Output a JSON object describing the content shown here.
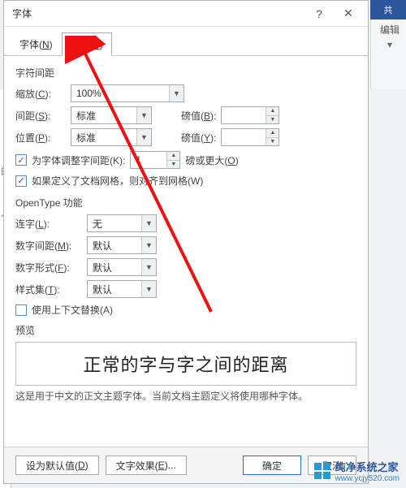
{
  "bg": {
    "share_label": "共",
    "edit_label": "编辑",
    "doc_char1": "的",
    "doc_char2": "入"
  },
  "dialog": {
    "title": "字体",
    "tabs": {
      "font": {
        "text": "字体(",
        "hotkey": "N",
        "suffix": ")"
      },
      "advanced": {
        "text": "高级(",
        "hotkey": "V",
        "suffix": ")"
      }
    },
    "section_spacing_title": "字符间距",
    "scale": {
      "label_pre": "缩放(",
      "hotkey": "C",
      "label_post": "):",
      "value": "100%"
    },
    "spacing": {
      "label_pre": "间距(",
      "hotkey": "S",
      "label_post": "):",
      "value": "标准",
      "pt_label_pre": "磅值(",
      "pt_hotkey": "B",
      "pt_label_post": "):",
      "pt_value": ""
    },
    "position": {
      "label_pre": "位置(",
      "hotkey": "P",
      "label_post": "):",
      "value": "标准",
      "pt_label_pre": "磅值(",
      "pt_hotkey": "Y",
      "pt_label_post": "):",
      "pt_value": ""
    },
    "kerning": {
      "checked": true,
      "label_pre": "为字体调整字间距(",
      "hotkey": "K",
      "label_post": "):",
      "value": "1",
      "unit_pre": "磅或更大(",
      "unit_hotkey": "O",
      "unit_post": ")"
    },
    "grid": {
      "checked": true,
      "label_pre": "如果定义了文档网格，则对齐到网格(",
      "hotkey": "W",
      "label_post": ")"
    },
    "section_opentype_title": "OpenType 功能",
    "ligature": {
      "label_pre": "连字(",
      "hotkey": "L",
      "label_post": "):",
      "value": "无"
    },
    "num_spacing": {
      "label_pre": "数字间距(",
      "hotkey": "M",
      "label_post": "):",
      "value": "默认"
    },
    "num_form": {
      "label_pre": "数字形式(",
      "hotkey": "F",
      "label_post": "):",
      "value": "默认"
    },
    "stylistic": {
      "label_pre": "样式集(",
      "hotkey": "T",
      "label_post": "):",
      "value": "默认"
    },
    "contextual": {
      "checked": false,
      "label_pre": "使用上下文替换(",
      "hotkey": "A",
      "label_post": ")"
    },
    "preview_title": "预览",
    "preview_text": "正常的字与字之间的距离",
    "preview_desc": "这是用于中文的正文主题字体。当前文档主题定义将使用哪种字体。",
    "footer": {
      "default_btn": {
        "pre": "设为默认值(",
        "hotkey": "D",
        "post": ")"
      },
      "effects_btn": {
        "pre": "文字效果(",
        "hotkey": "E",
        "post": ")..."
      },
      "ok_btn": "确定",
      "cancel_btn": "取消"
    }
  },
  "watermark": {
    "text": "纯净系统之家",
    "url": "www.ycjy520.com"
  }
}
